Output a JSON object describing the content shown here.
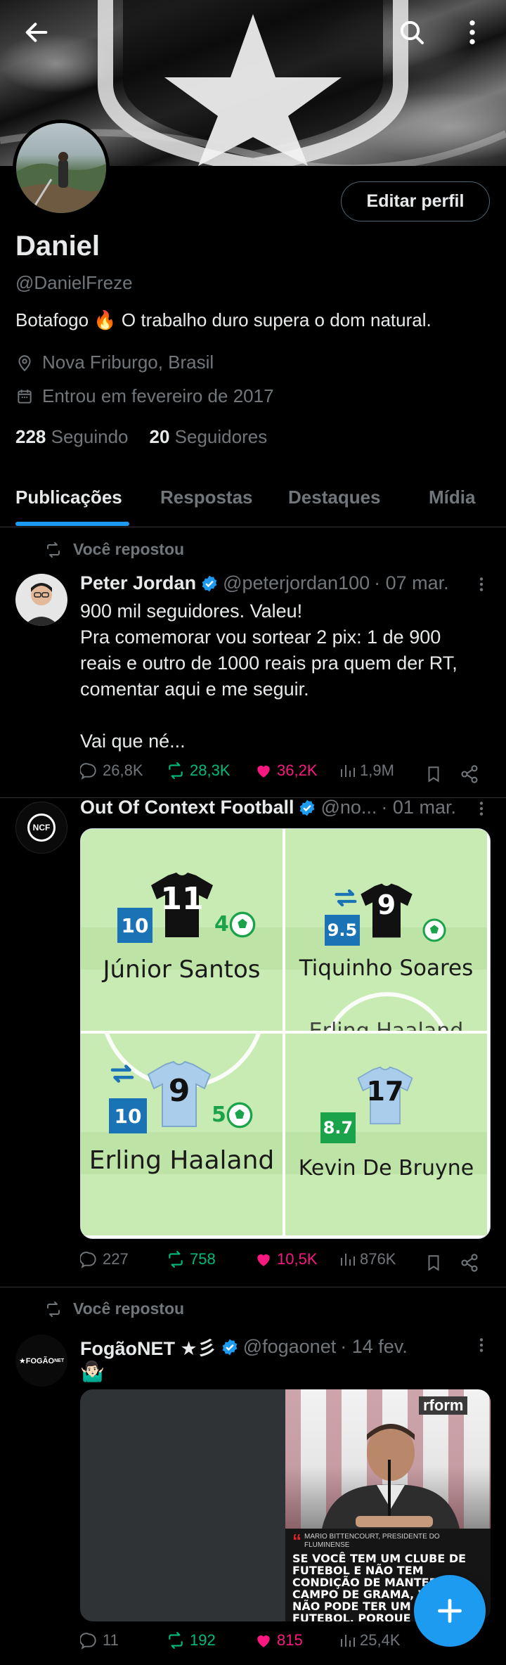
{
  "profile": {
    "name": "Daniel",
    "handle": "@DanielFreze",
    "bio": "Botafogo 🔥 O trabalho duro supera o dom natural.",
    "location": "Nova Friburgo, Brasil",
    "joined": "Entrou em fevereiro de 2017",
    "following_count": "228",
    "following_label": "Seguindo",
    "followers_count": "20",
    "followers_label": "Seguidores",
    "edit_label": "Editar perfil"
  },
  "tabs": [
    "Publicações",
    "Respostas",
    "Destaques",
    "Mídia"
  ],
  "posts": [
    {
      "repost_label": "Você repostou",
      "author": "Peter Jordan",
      "handle": "@peterjordan100",
      "date": "· 07 mar.",
      "text_lines": [
        "900 mil seguidores. Valeu!",
        "Pra comemorar vou sortear 2 pix: 1 de 900",
        "reais e outro de 1000 reais pra quem der RT,",
        "comentar aqui e me seguir.",
        "",
        "Vai que né..."
      ],
      "replies": "26,8K",
      "reposts": "28,3K",
      "likes": "36,2K",
      "views": "1,9M"
    },
    {
      "author": "Out Of Context Football",
      "handle": "@no...",
      "date": "· 01 mar.",
      "avatar_text": "NCF",
      "players": [
        {
          "name": "Júnior Santos",
          "number": "11",
          "rating": "10",
          "goals": "4"
        },
        {
          "name": "Tiquinho Soares",
          "number": "9",
          "rating": "9.5",
          "goals": ""
        },
        {
          "name": "Erling Haaland",
          "number": "9",
          "rating": "10",
          "goals": "5"
        },
        {
          "name": "Kevin De Bruyne",
          "number": "17",
          "rating": "8.7",
          "goals": ""
        }
      ],
      "ghost_text": "Erling Haaland",
      "replies": "227",
      "reposts": "758",
      "likes": "10,5K",
      "views": "876K"
    },
    {
      "repost_label": "Você repostou",
      "author": "FogãoNET ★彡",
      "handle": "@fogaonet",
      "date": "· 14 fev.",
      "emoji": "🤷🏻‍♂️",
      "avatar_text": "★FOGÃO",
      "avatar_suffix": "NET",
      "media_caption_name": "MARIO BITTENCOURT, PRESIDENTE DO FLUMINENSE",
      "media_caption_lines": [
        "SE VOCÊ TEM UM CLUBE DE",
        "FUTEBOL E NÃO TEM",
        "CONDIÇÃO DE MANTER UM",
        "CAMPO DE GRAMA, V",
        "NÃO PODE TER UM",
        "FUTEBOL, PORQUE"
      ],
      "media_brand": "rform",
      "replies": "11",
      "reposts": "192",
      "likes": "815",
      "views": "25,4K"
    }
  ],
  "colors": {
    "accent": "#1d9bf0",
    "repost": "#00ba7c",
    "like": "#f91880",
    "muted": "#71767b"
  }
}
